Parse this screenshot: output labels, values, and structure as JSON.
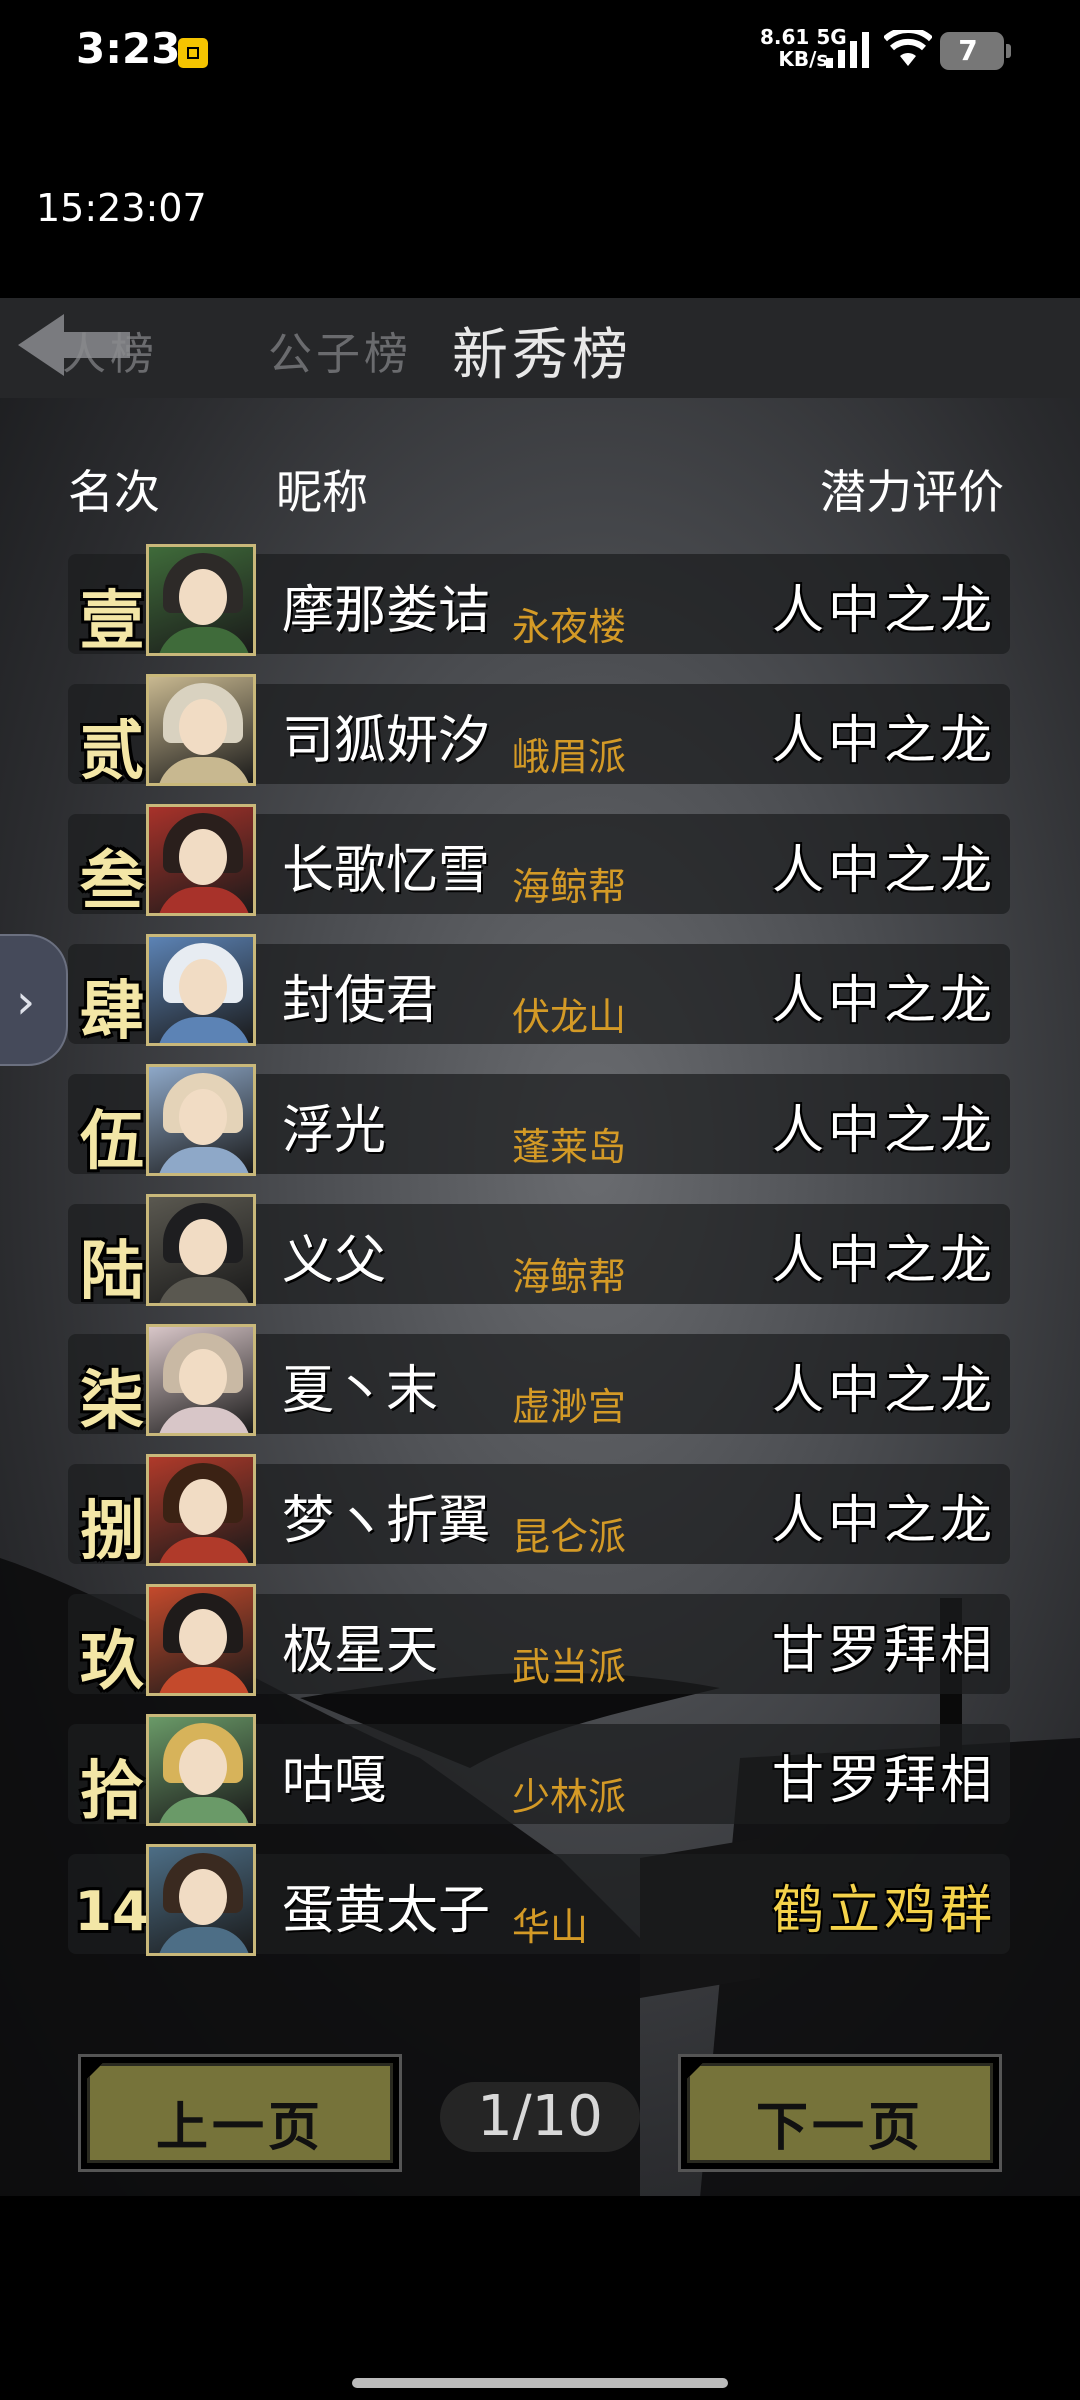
{
  "status_bar": {
    "time": "3:23",
    "net_speed_value": "8.61",
    "net_speed_unit": "KB/s",
    "network": "5G",
    "battery": "7"
  },
  "clock": "15:23:07",
  "tabs": [
    {
      "label": "人榜",
      "active": false
    },
    {
      "label": "公子榜",
      "active": false
    },
    {
      "label": "新秀榜",
      "active": true
    }
  ],
  "headers": {
    "rank": "名次",
    "nickname": "昵称",
    "rating": "潜力评价"
  },
  "rows": [
    {
      "rank": "壹",
      "nickname": "摩那娄诘",
      "sect": "永夜楼",
      "rating": "人中之龙",
      "avatar_colors": [
        "#2d2a28",
        "#3f6b3a"
      ]
    },
    {
      "rank": "贰",
      "nickname": "司狐妍汐",
      "sect": "峨眉派",
      "rating": "人中之龙",
      "avatar_colors": [
        "#d9d2c0",
        "#c8b890"
      ]
    },
    {
      "rank": "叁",
      "nickname": "长歌忆雪",
      "sect": "海鲸帮",
      "rating": "人中之龙",
      "avatar_colors": [
        "#2a1f1c",
        "#a8322a"
      ]
    },
    {
      "rank": "肆",
      "nickname": "封使君",
      "sect": "伏龙山",
      "rating": "人中之龙",
      "avatar_colors": [
        "#e7ecf2",
        "#5c83b5"
      ]
    },
    {
      "rank": "伍",
      "nickname": "浮光",
      "sect": "蓬莱岛",
      "rating": "人中之龙",
      "avatar_colors": [
        "#e4d3b8",
        "#8ea8c8"
      ]
    },
    {
      "rank": "陆",
      "nickname": "义父",
      "sect": "海鲸帮",
      "rating": "人中之龙",
      "avatar_colors": [
        "#1e1e20",
        "#5a5850"
      ]
    },
    {
      "rank": "柒",
      "nickname": "夏丶末",
      "sect": "虚渺宫",
      "rating": "人中之龙",
      "avatar_colors": [
        "#c9b9a4",
        "#d8c6c8"
      ]
    },
    {
      "rank": "捌",
      "nickname": "梦ヽ折翼",
      "sect": "昆仑派",
      "rating": "人中之龙",
      "avatar_colors": [
        "#3b2214",
        "#b03a2a"
      ]
    },
    {
      "rank": "玖",
      "nickname": "极星天",
      "sect": "武当派",
      "rating": "甘罗拜相",
      "avatar_colors": [
        "#1f1b1a",
        "#c44a2c"
      ]
    },
    {
      "rank": "拾",
      "nickname": "咕嘎",
      "sect": "少林派",
      "rating": "甘罗拜相",
      "avatar_colors": [
        "#d7b35a",
        "#6a9a68"
      ]
    },
    {
      "rank": "14",
      "nickname": "蛋黄太子",
      "sect": "华山",
      "rating": "鹤立鸡群",
      "avatar_colors": [
        "#3a2a20",
        "#4d6e86"
      ],
      "rating_gold": true
    }
  ],
  "pager": {
    "prev_label": "上一页",
    "next_label": "下一页",
    "page": "1/10"
  }
}
